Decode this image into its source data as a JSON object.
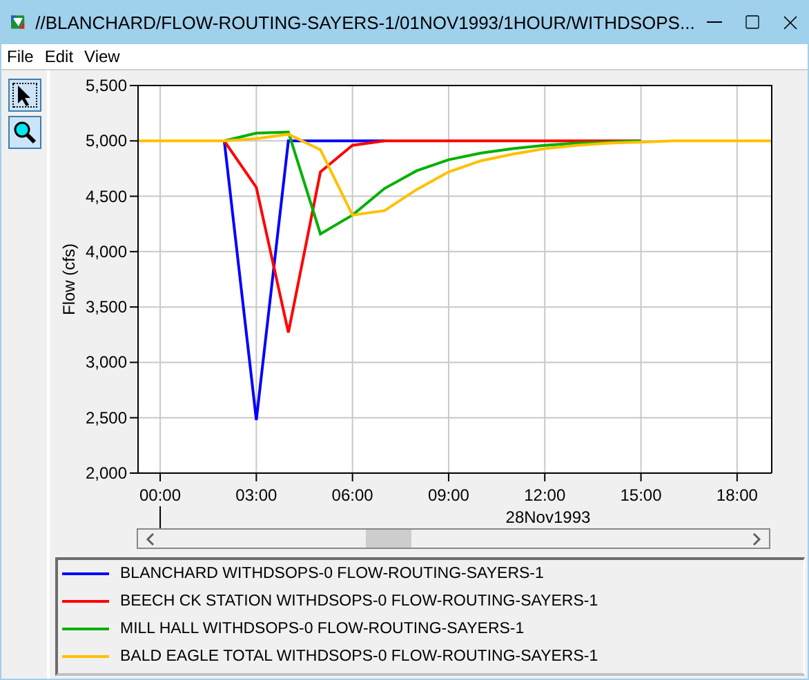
{
  "window": {
    "title": "//BLANCHARD/FLOW-ROUTING-SAYERS-1/01NOV1993/1HOUR/WITHDSOPS..."
  },
  "menu": [
    "File",
    "Edit",
    "View"
  ],
  "chart": {
    "chart_data": {
      "type": "line",
      "ylabel": "Flow (cfs)",
      "xlabel": "28Nov1993",
      "grid": true,
      "x": [
        -0.69,
        0,
        1,
        2,
        3,
        4,
        5,
        6,
        7,
        8,
        9,
        10,
        11,
        12,
        13,
        14,
        15,
        16,
        17,
        18,
        19,
        19.08
      ],
      "series": [
        {
          "name": "BLANCHARD WITHDSOPS-0 FLOW-ROUTING-SAYERS-1",
          "color": "#0000ff",
          "values": [
            null,
            null,
            null,
            5000,
            2480,
            5000,
            5000,
            5000,
            5000,
            null,
            null,
            null,
            null,
            null,
            null,
            null,
            null,
            null,
            null,
            null,
            null,
            null
          ]
        },
        {
          "name": "BEECH CK STATION WITHDSOPS-0 FLOW-ROUTING-SAYERS-1",
          "color": "#ff0000",
          "values": [
            null,
            null,
            null,
            5000,
            4580,
            3270,
            4720,
            4960,
            5000,
            5000,
            5000,
            5000,
            5000,
            5000,
            5000,
            5000,
            5000,
            null,
            null,
            null,
            null,
            null
          ]
        },
        {
          "name": "MILL HALL WITHDSOPS-0 FLOW-ROUTING-SAYERS-1",
          "color": "#00b000",
          "values": [
            null,
            null,
            null,
            5000,
            5070,
            5080,
            4160,
            4330,
            4570,
            4730,
            4830,
            4890,
            4930,
            4960,
            4980,
            4990,
            5000,
            null,
            null,
            null,
            null,
            null
          ]
        },
        {
          "name": "BALD EAGLE TOTAL WITHDSOPS-0 FLOW-ROUTING-SAYERS-1",
          "color": "#ffc000",
          "values": [
            5000,
            5000,
            5000,
            5000,
            5020,
            5060,
            4920,
            4330,
            4370,
            4560,
            4720,
            4820,
            4880,
            4930,
            4960,
            4980,
            4990,
            5000,
            5000,
            5000,
            5000,
            5000
          ]
        }
      ],
      "xlim": [
        -0.69,
        19.08
      ],
      "ylim": [
        2000,
        5500
      ],
      "xticks": [
        {
          "value": 0,
          "label": "00:00"
        },
        {
          "value": 3,
          "label": "03:00"
        },
        {
          "value": 6,
          "label": "06:00"
        },
        {
          "value": 9,
          "label": "09:00"
        },
        {
          "value": 12,
          "label": "12:00"
        },
        {
          "value": 15,
          "label": "15:00"
        },
        {
          "value": 18,
          "label": "18:00"
        }
      ],
      "yticks": [
        {
          "value": 2000,
          "label": "2,000"
        },
        {
          "value": 2500,
          "label": "2,500"
        },
        {
          "value": 3000,
          "label": "3,000"
        },
        {
          "value": 3500,
          "label": "3,500"
        },
        {
          "value": 4000,
          "label": "4,000"
        },
        {
          "value": 4500,
          "label": "4,500"
        },
        {
          "value": 5000,
          "label": "5,000"
        },
        {
          "value": 5500,
          "label": "5,500"
        }
      ]
    }
  }
}
